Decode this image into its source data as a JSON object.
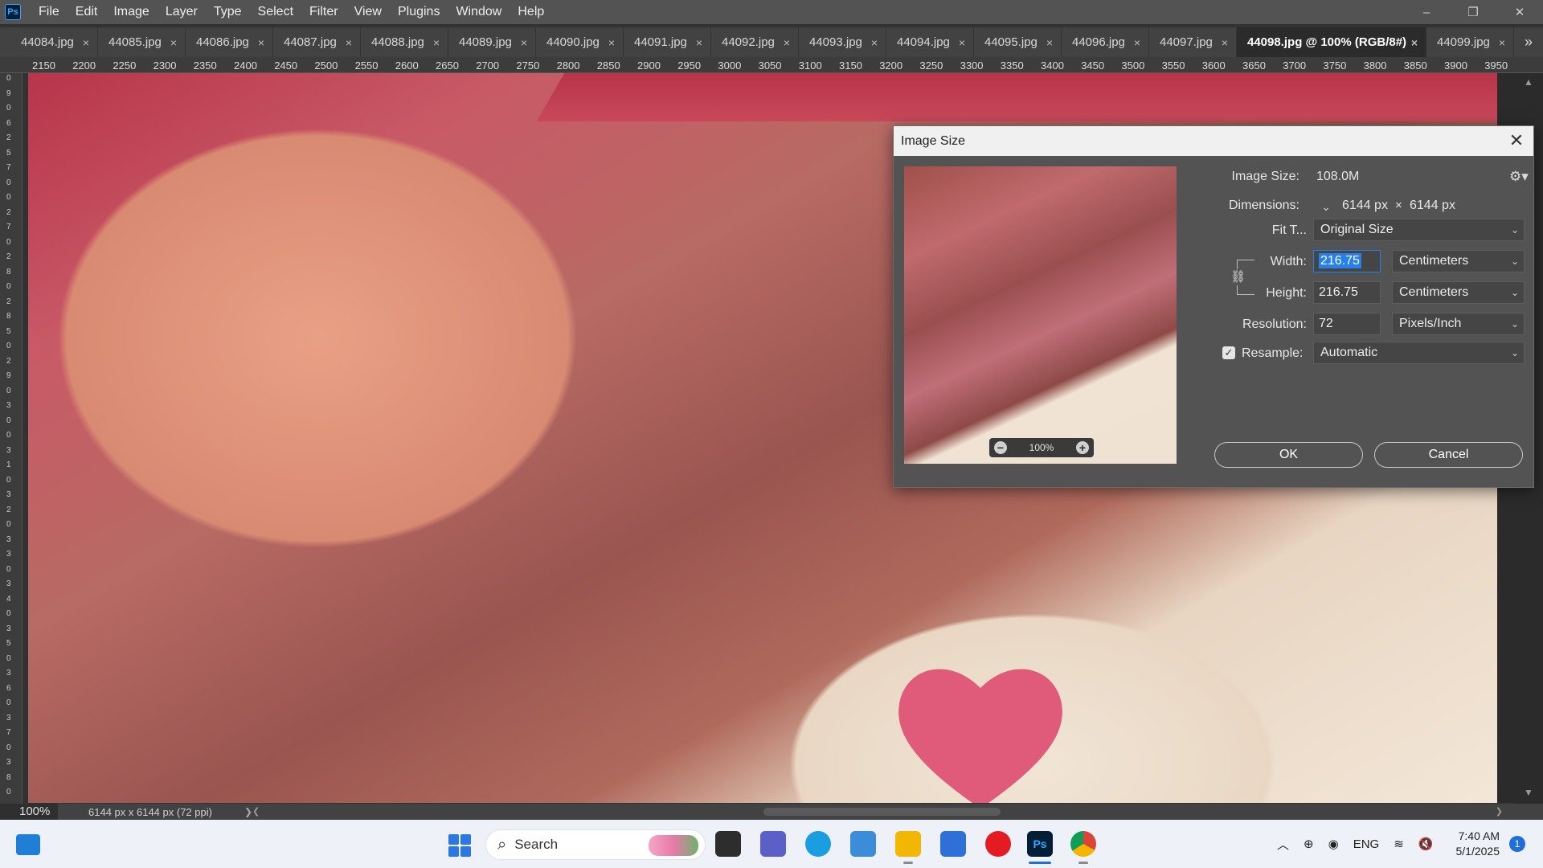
{
  "menubar": {
    "logo": "Ps",
    "items": [
      "File",
      "Edit",
      "Image",
      "Layer",
      "Type",
      "Select",
      "Filter",
      "View",
      "Plugins",
      "Window",
      "Help"
    ],
    "min_glyph": "–",
    "max_glyph": "❐",
    "close_glyph": "✕"
  },
  "tabs": [
    {
      "label": "44084.jpg",
      "active": false
    },
    {
      "label": "44085.jpg",
      "active": false
    },
    {
      "label": "44086.jpg",
      "active": false
    },
    {
      "label": "44087.jpg",
      "active": false
    },
    {
      "label": "44088.jpg",
      "active": false
    },
    {
      "label": "44089.jpg",
      "active": false
    },
    {
      "label": "44090.jpg",
      "active": false
    },
    {
      "label": "44091.jpg",
      "active": false
    },
    {
      "label": "44092.jpg",
      "active": false
    },
    {
      "label": "44093.jpg",
      "active": false
    },
    {
      "label": "44094.jpg",
      "active": false
    },
    {
      "label": "44095.jpg",
      "active": false
    },
    {
      "label": "44096.jpg",
      "active": false
    },
    {
      "label": "44097.jpg",
      "active": false
    },
    {
      "label": "44098.jpg @ 100% (RGB/8#)",
      "active": true
    },
    {
      "label": "44099.jpg",
      "active": false
    }
  ],
  "tab_close_glyph": "×",
  "tab_overflow_glyph": "»",
  "ruler_top": [
    "2150",
    "2200",
    "2250",
    "2300",
    "2350",
    "2400",
    "2450",
    "2500",
    "2550",
    "2600",
    "2650",
    "2700",
    "2750",
    "2800",
    "2850",
    "2900",
    "2950",
    "3000",
    "3050",
    "3100",
    "3150",
    "3200",
    "3250",
    "3300",
    "3350",
    "3400",
    "3450",
    "3500",
    "3550",
    "3600",
    "3650",
    "3700",
    "3750",
    "3800",
    "3850",
    "3900",
    "3950"
  ],
  "ruler_left": [
    "0",
    "9",
    "0",
    "6",
    "2",
    "5",
    "7",
    "0",
    "0",
    "2",
    "7",
    "0",
    "2",
    "8",
    "0",
    "2",
    "8",
    "5",
    "0",
    "2",
    "9",
    "0",
    "3",
    "0",
    "0",
    "3",
    "1",
    "0",
    "3",
    "2",
    "0",
    "3",
    "3",
    "0",
    "3",
    "4",
    "0",
    "3",
    "5",
    "0",
    "3",
    "6",
    "0",
    "3",
    "7",
    "0",
    "3",
    "8",
    "0"
  ],
  "status": {
    "zoom": "100%",
    "doc_info": "6144 px x 6144 px (72 ppi)",
    "arrow_glyph": "❯"
  },
  "dialog": {
    "title": "Image Size",
    "close_glyph": "✕",
    "preview_zoom": "100%",
    "image_size_label": "Image Size:",
    "image_size_value": "108.0M",
    "dimensions_label": "Dimensions:",
    "dim_width": "6144 px",
    "dim_sep": "×",
    "dim_height": "6144 px",
    "fit_label": "Fit T...",
    "fit_value": "Original Size",
    "width_label": "Width:",
    "width_value": "216.75",
    "width_unit": "Centimeters",
    "height_label": "Height:",
    "height_value": "216.75",
    "height_unit": "Centimeters",
    "resolution_label": "Resolution:",
    "resolution_value": "72",
    "resolution_unit": "Pixels/Inch",
    "resample_label": "Resample:",
    "resample_checked": true,
    "resample_value": "Automatic",
    "ok_label": "OK",
    "cancel_label": "Cancel"
  },
  "taskbar": {
    "search_placeholder": "Search",
    "apps": [
      "file-explorer",
      "teams",
      "edge",
      "lens",
      "folder",
      "store",
      "opera",
      "photoshop",
      "chrome"
    ],
    "ps_label": "Ps",
    "tray_lang": "ENG",
    "time": "7:40 AM",
    "date": "5/1/2025",
    "notification_count": "1"
  },
  "colors": {
    "accent": "#2680eb",
    "ps_blue": "#31a8ff",
    "canvas_red": "#b8344a",
    "heart_pink": "#e05a7a"
  }
}
